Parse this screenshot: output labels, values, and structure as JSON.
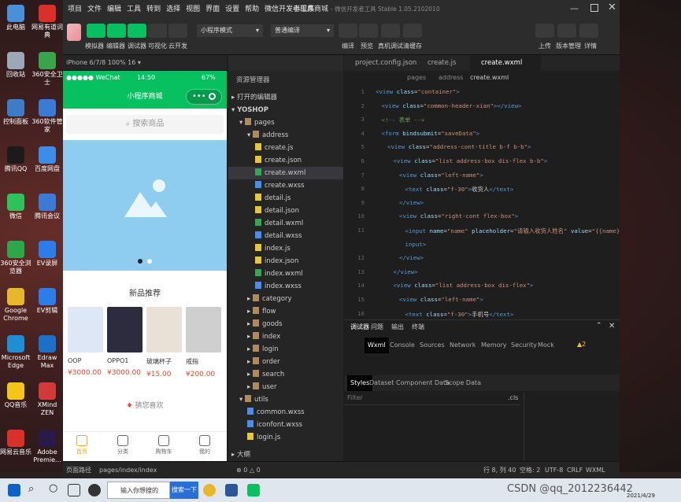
{
  "desktop": {
    "left_icons": [
      {
        "label": "此电脑",
        "color": "#4a90d9"
      },
      {
        "label": "回收站",
        "color": "#9aa8b8"
      },
      {
        "label": "控制面板",
        "color": "#3e7cc8"
      },
      {
        "label": "腾讯QQ",
        "color": "#1b1b1b"
      },
      {
        "label": "微信",
        "color": "#2ec35a"
      },
      {
        "label": "360安全浏览器",
        "color": "#2aa84a"
      },
      {
        "label": "Google Chrome",
        "color": "#e8b82a"
      },
      {
        "label": "Microsoft Edge",
        "color": "#1e8fd6"
      },
      {
        "label": "QQ音乐",
        "color": "#f5c518"
      },
      {
        "label": "网易云音乐",
        "color": "#d9302a"
      }
    ],
    "right_icons": [
      {
        "label": "网易有道词典",
        "color": "#d9302a"
      },
      {
        "label": "360安全卫士",
        "color": "#39a54b"
      },
      {
        "label": "360软件管家",
        "color": "#3a7bd5"
      },
      {
        "label": "百度网盘",
        "color": "#3b8ee8"
      },
      {
        "label": "腾讯会议",
        "color": "#3a7bd5"
      },
      {
        "label": "EV录屏",
        "color": "#2b7de9"
      },
      {
        "label": "EV剪辑",
        "color": "#2b7de9"
      },
      {
        "label": "Edraw Max",
        "color": "#1c70c8"
      },
      {
        "label": "XMind ZEN",
        "color": "#d23a3a"
      },
      {
        "label": "Adobe Premie...",
        "color": "#2a1a4a"
      }
    ]
  },
  "menu": [
    "项目",
    "文件",
    "编辑",
    "工具",
    "转到",
    "选择",
    "视图",
    "界面",
    "设置",
    "帮助",
    "微信开发者工具"
  ],
  "window_title": "小程序商城",
  "window_subtitle": "- 微信开发者工具 Stable 1.05.2102010",
  "toolbar": {
    "left_labels": [
      "模拟器",
      "编辑器",
      "调试器",
      "可视化",
      "云开发"
    ],
    "mode_select": "小程序模式",
    "compile_select": "普通编译",
    "mid_labels": [
      "编译",
      "预览",
      "真机调试",
      "清缓存"
    ],
    "right_labels": [
      "上传",
      "版本管理",
      "详情"
    ]
  },
  "simulator": {
    "device": "iPhone 6/7/8 100% 16 ▾",
    "status_left": "●●●●● WeChat",
    "status_time": "14:50",
    "status_battery": "67%",
    "nav_title": "小程序商城",
    "search_placeholder": "搜索商品",
    "section_new": "新品推荐",
    "section_guess": "猜您喜欢",
    "products": [
      {
        "name": "OOP",
        "price": "¥3000.00",
        "color": "#dde7f5"
      },
      {
        "name": "OPPO1",
        "price": "¥3000.00",
        "color": "#2c2c3e"
      },
      {
        "name": "玻璃杯子",
        "price": "¥15.00",
        "color": "#e9e0d6"
      },
      {
        "name": "戒指",
        "price": "¥200.00",
        "color": "#cfcfcf"
      }
    ],
    "tabs": [
      "首页",
      "分类",
      "购物车",
      "我的"
    ],
    "active_tab_color": "#f5a623"
  },
  "explorer": {
    "title": "资源管理器",
    "open_editors": "打开的编辑器",
    "project": "YOSHOP",
    "tree": [
      {
        "label": "pages",
        "depth": 1,
        "type": "folder",
        "open": true
      },
      {
        "label": "address",
        "depth": 2,
        "type": "folder",
        "open": true
      },
      {
        "label": "create.js",
        "depth": 3,
        "type": "js"
      },
      {
        "label": "create.json",
        "depth": 3,
        "type": "json"
      },
      {
        "label": "create.wxml",
        "depth": 3,
        "type": "wxml",
        "selected": true
      },
      {
        "label": "create.wxss",
        "depth": 3,
        "type": "wxss"
      },
      {
        "label": "detail.js",
        "depth": 3,
        "type": "js"
      },
      {
        "label": "detail.json",
        "depth": 3,
        "type": "json"
      },
      {
        "label": "detail.wxml",
        "depth": 3,
        "type": "wxml"
      },
      {
        "label": "detail.wxss",
        "depth": 3,
        "type": "wxss"
      },
      {
        "label": "index.js",
        "depth": 3,
        "type": "js"
      },
      {
        "label": "index.json",
        "depth": 3,
        "type": "json"
      },
      {
        "label": "index.wxml",
        "depth": 3,
        "type": "wxml"
      },
      {
        "label": "index.wxss",
        "depth": 3,
        "type": "wxss"
      },
      {
        "label": "category",
        "depth": 2,
        "type": "folder"
      },
      {
        "label": "flow",
        "depth": 2,
        "type": "folder"
      },
      {
        "label": "goods",
        "depth": 2,
        "type": "folder"
      },
      {
        "label": "index",
        "depth": 2,
        "type": "folder"
      },
      {
        "label": "login",
        "depth": 2,
        "type": "folder"
      },
      {
        "label": "order",
        "depth": 2,
        "type": "folder"
      },
      {
        "label": "search",
        "depth": 2,
        "type": "folder"
      },
      {
        "label": "user",
        "depth": 2,
        "type": "folder"
      },
      {
        "label": "utils",
        "depth": 1,
        "type": "folder",
        "open": true
      },
      {
        "label": "common.wxss",
        "depth": 2,
        "type": "wxss"
      },
      {
        "label": "iconfont.wxss",
        "depth": 2,
        "type": "wxss"
      },
      {
        "label": "login.js",
        "depth": 2,
        "type": "js"
      }
    ],
    "outline": "大纲"
  },
  "editor": {
    "tabs": [
      "project.config.json",
      "create.js",
      "create.wxml"
    ],
    "active_tab": 2,
    "breadcrumb": [
      "pages",
      "address",
      "create.wxml"
    ],
    "lines": [
      {
        "n": "1",
        "html": "<span class='tg'>&lt;view</span> <span class='at'>class</span>=<span class='st'>\"container\"</span><span class='tg'>&gt;</span>",
        "indent": 0
      },
      {
        "n": "2",
        "html": "<span class='tg'>&lt;view</span> <span class='at'>class</span>=<span class='st'>\"common-header-xian\"</span><span class='tg'>&gt;&lt;/view&gt;</span>",
        "indent": 1
      },
      {
        "n": "3",
        "html": "<span class='cm'>&lt;!-- 表单 --&gt;</span>",
        "indent": 1
      },
      {
        "n": "4",
        "html": "<span class='tg'>&lt;form</span> <span class='at'>bindsubmit</span>=<span class='st'>\"saveData\"</span><span class='tg'>&gt;</span>",
        "indent": 1
      },
      {
        "n": "5",
        "html": "<span class='tg'>&lt;view</span> <span class='at'>class</span>=<span class='st'>\"address-cont-title b-f b-b\"</span><span class='tg'>&gt;</span>",
        "indent": 2
      },
      {
        "n": "6",
        "html": "<span class='tg'>&lt;view</span> <span class='at'>class</span>=<span class='st'>\"list address-box dis-flex b-b\"</span><span class='tg'>&gt;</span>",
        "indent": 3
      },
      {
        "n": "7",
        "html": "<span class='tg'>&lt;view</span> <span class='at'>class</span>=<span class='st'>\"left-name\"</span><span class='tg'>&gt;</span>",
        "indent": 4
      },
      {
        "n": "8",
        "html": "<span class='tg'>&lt;text</span> <span class='at'>class</span>=<span class='st'>\"f-30\"</span><span class='tg'>&gt;</span>收货人<span class='tg'>&lt;/text&gt;</span>",
        "indent": 5
      },
      {
        "n": "9",
        "html": "<span class='tg'>&lt;/view&gt;</span>",
        "indent": 4
      },
      {
        "n": "10",
        "html": "<span class='tg'>&lt;view</span> <span class='at'>class</span>=<span class='st'>\"right-cont flex-box\"</span><span class='tg'>&gt;</span>",
        "indent": 4
      },
      {
        "n": "11",
        "html": "<span class='tg'>&lt;input</span> <span class='at'>name</span>=<span class='st'>\"name\"</span> <span class='at'>placeholder</span>=<span class='st'>\"请输入收货人姓名\"</span> <span class='at'>value</span>=<span class='st'>\"{{name}}\"</span><span class='tg'>&gt;&lt;/</span>",
        "indent": 5
      },
      {
        "n": "",
        "html": "<span class='tg'>input&gt;</span>",
        "indent": 5
      },
      {
        "n": "12",
        "html": "<span class='tg'>&lt;/view&gt;</span>",
        "indent": 4
      },
      {
        "n": "13",
        "html": "<span class='tg'>&lt;/view&gt;</span>",
        "indent": 3
      },
      {
        "n": "14",
        "html": "<span class='tg'>&lt;view</span> <span class='at'>class</span>=<span class='st'>\"list address-box dis-flex\"</span><span class='tg'>&gt;</span>",
        "indent": 3
      },
      {
        "n": "15",
        "html": "<span class='tg'>&lt;view</span> <span class='at'>class</span>=<span class='st'>\"left-name\"</span><span class='tg'>&gt;</span>",
        "indent": 4
      },
      {
        "n": "16",
        "html": "<span class='tg'>&lt;text</span> <span class='at'>class</span>=<span class='st'>\"f-30\"</span><span class='tg'>&gt;</span>手机号<span class='tg'>&lt;/text&gt;</span>",
        "indent": 5
      }
    ]
  },
  "devtools": {
    "top_tabs": [
      "调试器",
      "问题",
      "输出",
      "终端"
    ],
    "tabs": [
      "Wxml",
      "Console",
      "Sources",
      "Network",
      "Memory",
      "Security",
      "Mock"
    ],
    "warning_count": "2",
    "sub_tabs": [
      "Styles",
      "Dataset",
      "Component Data",
      "Scope Data"
    ],
    "filter_placeholder": "Filter",
    "cls_label": ".cls"
  },
  "pathbar": {
    "label": "页面路径",
    "path": "pages/index/index",
    "errors": "0",
    "warnings": "0",
    "status_items": [
      "行 8, 列 40",
      "空格: 2",
      "UTF-8",
      "CRLF",
      "WXML"
    ]
  },
  "taskbar": {
    "search_placeholder": "输入你想搜的",
    "search_button": "搜索一下",
    "watermark": "CSDN @qq_2012236442",
    "date": "2021/4/29"
  }
}
